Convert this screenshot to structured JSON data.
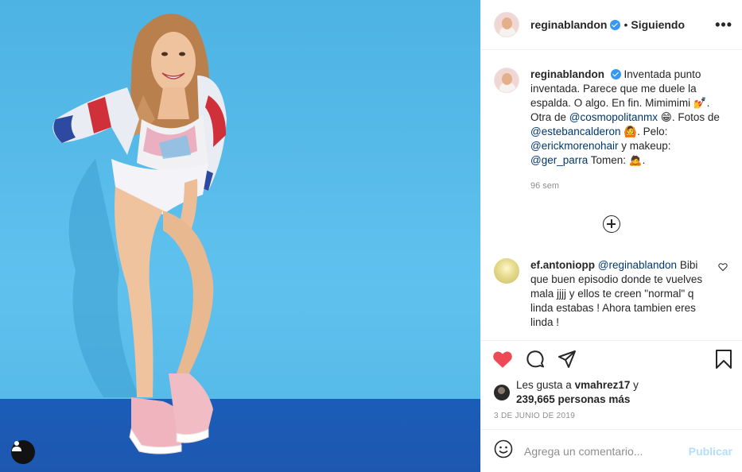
{
  "header": {
    "username": "reginablandon",
    "separator": "•",
    "follow_status": "Siguiendo",
    "more_label": "•••"
  },
  "caption": {
    "username": "reginablandon",
    "text_1": "Inventada punto inventada. Parece que me duele la espalda. O algo. En fin. Mimimimi 💅. Otra de ",
    "mention_1": "@cosmopolitanmx",
    "text_2": " 😁. Fotos de ",
    "mention_2": "@estebancalderon",
    "text_3": " 🙆. Pelo: ",
    "mention_3": "@erickmorenohair",
    "text_4": " y makeup: ",
    "mention_4": "@ger_parra",
    "text_5": " Tomen: 🙇.",
    "time_ago": "96 sem"
  },
  "comments": [
    {
      "username": "ef.antoniopp",
      "mention": "@reginablandon",
      "text": "Bibi que buen episodio donde te vuelves mala jjjj y ellos te creen \"normal\" q linda estabas ! Ahora tambien eres linda !"
    }
  ],
  "likes": {
    "prefix": "Les gusta a ",
    "first_user": "vmahrez17",
    "connector": " y",
    "others": "239,665 personas más"
  },
  "date": "3 DE JUNIO DE 2019",
  "add_comment": {
    "placeholder": "Agrega un comentario...",
    "publish_label": "Publicar"
  },
  "icons": {
    "like": "heart-filled-icon",
    "comment": "comment-icon",
    "share": "paper-plane-icon",
    "save": "bookmark-icon",
    "emoji": "smiley-icon",
    "tag": "user-tag-icon",
    "load_more": "plus-circle-icon"
  },
  "colors": {
    "heart": "#ed4956",
    "mention": "#00376b",
    "verified": "#3897f0",
    "publish_disabled": "#b2dffc",
    "photo_bg": "#5fc1ee",
    "photo_floor": "#1e57b0"
  }
}
